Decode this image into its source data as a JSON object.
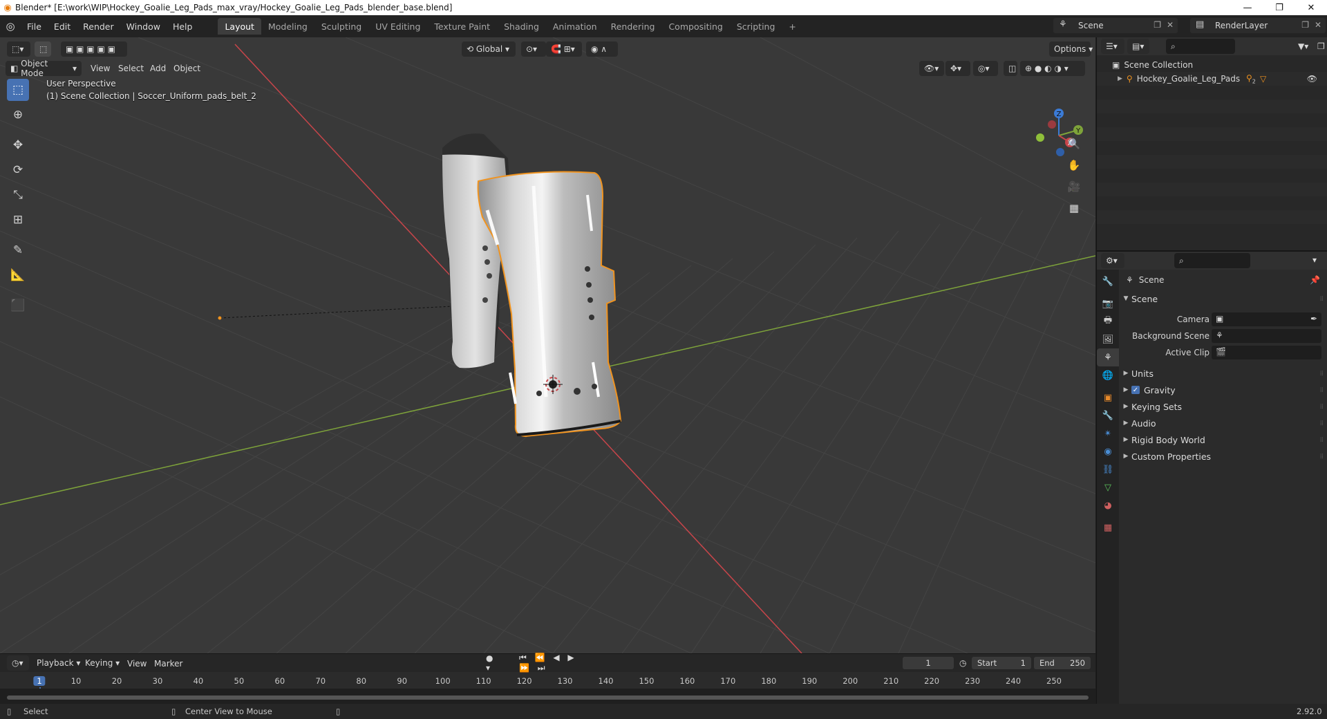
{
  "window": {
    "title": "Blender* [E:\\work\\WIP\\Hockey_Goalie_Leg_Pads_max_vray/Hockey_Goalie_Leg_Pads_blender_base.blend]",
    "minimize": "—",
    "maximize": "❐",
    "close": "✕"
  },
  "menu": [
    "File",
    "Edit",
    "Render",
    "Window",
    "Help"
  ],
  "workspaces": [
    "Layout",
    "Modeling",
    "Sculpting",
    "UV Editing",
    "Texture Paint",
    "Shading",
    "Animation",
    "Rendering",
    "Compositing",
    "Scripting"
  ],
  "workspace_add": "+",
  "scene_name": "Scene",
  "render_layer": "RenderLayer",
  "viewport": {
    "transform_orientation": "Global",
    "options_label": "Options",
    "mode": "Object Mode",
    "menus": [
      "View",
      "Select",
      "Add",
      "Object"
    ],
    "info_line1": "User Perspective",
    "info_line2": "(1) Scene Collection | Soccer_Uniform_pads_belt_2",
    "gizmo": {
      "x": "X",
      "y": "Y",
      "z": "Z"
    }
  },
  "timeline": {
    "menus": [
      "Playback",
      "Keying",
      "View",
      "Marker"
    ],
    "current_frame": "1",
    "start_label": "Start",
    "start_value": "1",
    "end_label": "End",
    "end_value": "250",
    "ticks": [
      "1",
      "10",
      "20",
      "30",
      "40",
      "50",
      "60",
      "70",
      "80",
      "90",
      "100",
      "110",
      "120",
      "130",
      "140",
      "150",
      "160",
      "170",
      "180",
      "190",
      "200",
      "210",
      "220",
      "230",
      "240",
      "250"
    ]
  },
  "statusbar": {
    "left": "Select",
    "middle": "Center View to Mouse",
    "version": "2.92.0"
  },
  "outliner": {
    "collection": "Scene Collection",
    "object": "Hockey_Goalie_Leg_Pads",
    "object_badge": "2"
  },
  "properties": {
    "context": "Scene",
    "panel_title": "Scene",
    "camera_label": "Camera",
    "background_label": "Background Scene",
    "clip_label": "Active Clip",
    "panels": [
      "Units",
      "Gravity",
      "Keying Sets",
      "Audio",
      "Rigid Body World",
      "Custom Properties"
    ]
  },
  "colors": {
    "accent": "#4772b3",
    "selection_outline": "#f0931f",
    "x_axis": "#c8454a",
    "y_axis": "#7ea33a"
  }
}
